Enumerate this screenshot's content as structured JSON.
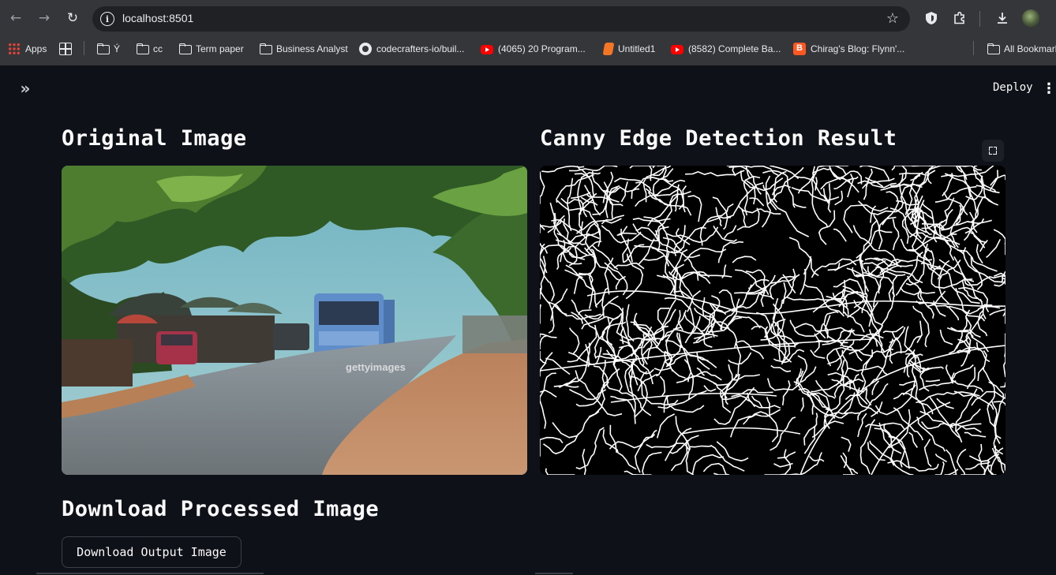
{
  "browser": {
    "url": "localhost:8501",
    "bookmarks": [
      {
        "label": "Apps",
        "icon": "apps-icon"
      },
      {
        "label": "Ý",
        "icon": "folder-icon"
      },
      {
        "label": "cc",
        "icon": "folder-icon"
      },
      {
        "label": "Term paper",
        "icon": "folder-icon"
      },
      {
        "label": "Business Analyst",
        "icon": "folder-icon"
      },
      {
        "label": "codecrafters-io/buil...",
        "icon": "github-icon"
      },
      {
        "label": "(4065) 20 Program...",
        "icon": "youtube-icon"
      },
      {
        "label": "Untitled1",
        "icon": "jupyter-icon"
      },
      {
        "label": "(8582) Complete Ba...",
        "icon": "youtube-icon"
      },
      {
        "label": "Chirag's Blog: Flynn'...",
        "icon": "blogger-icon"
      },
      {
        "label": "All Bookmarks",
        "icon": "folder-icon"
      }
    ]
  },
  "app": {
    "header": {
      "deploy_label": "Deploy",
      "menu_glyph": "⋮",
      "expand_glyph": "»"
    },
    "original": {
      "heading": "Original Image",
      "watermark": "gettyimages"
    },
    "result": {
      "heading": "Canny Edge Detection Result"
    },
    "download": {
      "heading": "Download Processed Image",
      "button_label": "Download Output Image"
    }
  },
  "colors": {
    "app_background": "#0e1117",
    "chrome_background": "#35363a",
    "text": "#fafafa",
    "edge_background": "#000000",
    "edge_stroke": "#ffffff"
  }
}
